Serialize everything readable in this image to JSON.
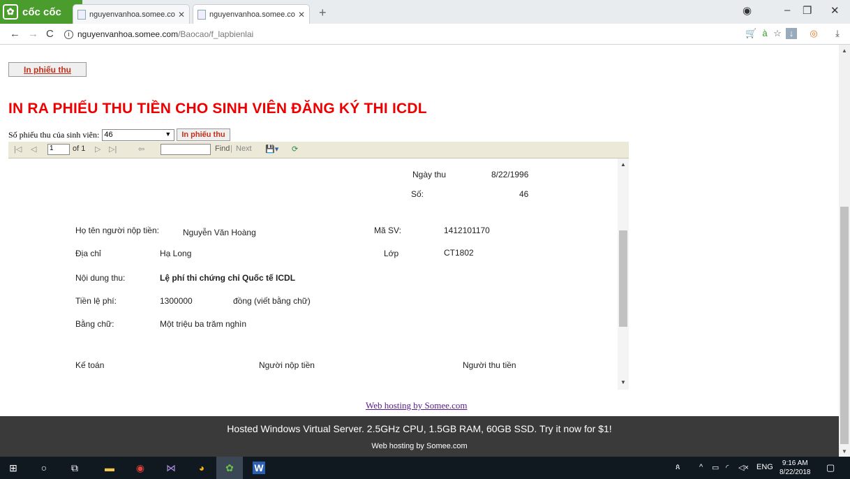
{
  "browser": {
    "logo_text": "cốc cốc",
    "tabs": [
      {
        "title": "nguyenvanhoa.somee.com"
      },
      {
        "title": "nguyenvanhoa.somee.com"
      }
    ],
    "address": {
      "host": "nguyenvanhoa.somee.com",
      "path": "/Baocao/f_lapbienlai"
    }
  },
  "page": {
    "top_button": "In phiếu thu",
    "heading": "IN RA PHIẾU THU TIỀN CHO SINH VIÊN ĐĂNG KÝ THI ICDL",
    "select_label": "Số phiếu thu của sinh viên:",
    "select_value": "46",
    "print_button": "In phiếu thu",
    "toolbar": {
      "page_value": "1",
      "of_label": "of 1",
      "find_label": "Find",
      "next_label": "Next"
    },
    "receipt": {
      "date_label": "Ngày thu",
      "date_value": "8/22/1996",
      "no_label": "Số:",
      "no_value": "46",
      "payer_label": "Họ tên người nộp tiền:",
      "payer_value": "Nguyễn Văn Hoàng",
      "student_id_label": "Mã SV:",
      "student_id_value": "1412101170",
      "address_label": "Địa chỉ",
      "address_value": "Hạ Long",
      "class_label": "Lớp",
      "class_value": "CT1802",
      "content_label": "Nội dung thu:",
      "content_value": "Lệ phí thi chứng chỉ Quốc tế ICDL",
      "fee_label": "Tiền lệ phí:",
      "fee_value": "1300000",
      "fee_unit": "đồng (viết bằng chữ)",
      "words_label": "Bằng chữ:",
      "words_value": "Một triệu ba trăm nghìn",
      "sign_accountant": "Kế toán",
      "sign_payer": "Người nộp tiền",
      "sign_receiver": "Người thu tiền"
    },
    "footer_link": "Web hosting by Somee.com",
    "banner_line1": "Hosted Windows Virtual Server. 2.5GHz CPU, 1.5GB RAM, 60GB SSD. Try it now for $1!",
    "banner_line2": "Web hosting by Somee.com"
  },
  "taskbar": {
    "lang": "ENG",
    "time": "9:16 AM",
    "date": "8/22/2018"
  }
}
